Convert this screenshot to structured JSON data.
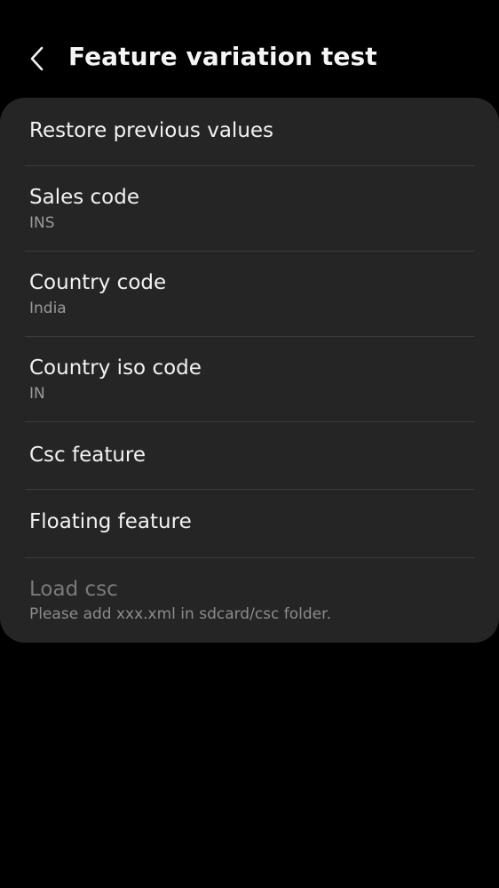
{
  "header": {
    "title": "Feature variation test"
  },
  "items": [
    {
      "title": "Restore previous values"
    },
    {
      "title": "Sales code",
      "subtitle": "INS"
    },
    {
      "title": "Country code",
      "subtitle": "India"
    },
    {
      "title": "Country iso code",
      "subtitle": "IN"
    },
    {
      "title": "Csc feature"
    },
    {
      "title": "Floating feature"
    },
    {
      "title": "Load csc",
      "subtitle": "Please add xxx.xml in sdcard/csc folder.",
      "disabled": true
    }
  ]
}
